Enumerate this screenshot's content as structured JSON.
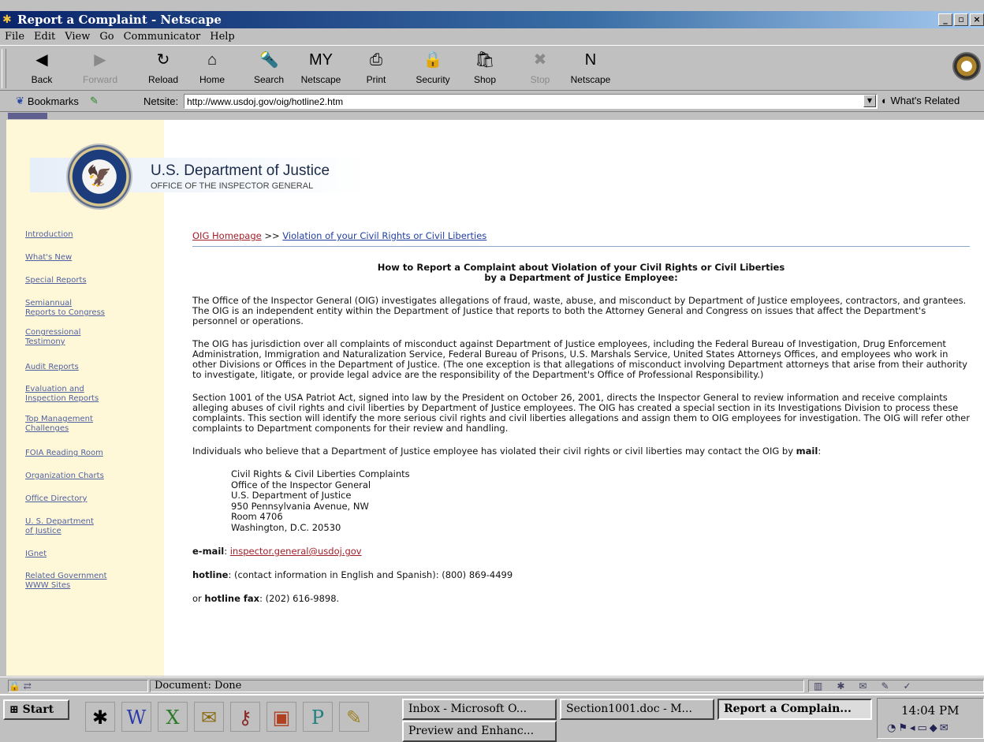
{
  "window": {
    "title": "Report a Complaint - Netscape"
  },
  "menu": [
    "File",
    "Edit",
    "View",
    "Go",
    "Communicator",
    "Help"
  ],
  "toolbar": [
    {
      "label": "Back",
      "icon": "◀",
      "disabled": false
    },
    {
      "label": "Forward",
      "icon": "▶",
      "disabled": true
    },
    {
      "label": "Reload",
      "icon": "↻",
      "disabled": false
    },
    {
      "label": "Home",
      "icon": "⌂",
      "disabled": false
    },
    {
      "label": "Search",
      "icon": "🔦",
      "disabled": false
    },
    {
      "label": "Netscape",
      "icon": "MY",
      "disabled": false
    },
    {
      "label": "Print",
      "icon": "⎙",
      "disabled": false
    },
    {
      "label": "Security",
      "icon": "🔒",
      "disabled": false
    },
    {
      "label": "Shop",
      "icon": "🛍",
      "disabled": false
    },
    {
      "label": "Stop",
      "icon": "✖",
      "disabled": true
    },
    {
      "label": "Netscape",
      "icon": "N",
      "disabled": false
    }
  ],
  "location": {
    "bookmarks_label": "Bookmarks",
    "netsite_label": "Netsite:",
    "url": "http://www.usdoj.gov/oig/hotline2.htm",
    "related_label": "What's Related"
  },
  "header": {
    "dept": "U.S. Department of Justice",
    "office": "OFFICE OF THE INSPECTOR GENERAL"
  },
  "nav": [
    [
      "Introduction"
    ],
    [
      "What's New"
    ],
    [
      "Special Reports"
    ],
    [
      "Semiannual",
      "Reports to Congress"
    ],
    [
      "Congressional",
      "Testimony"
    ],
    [
      "Audit Reports"
    ],
    [
      "Evaluation and",
      "Inspection Reports"
    ],
    [
      "Top Management",
      "Challenges"
    ],
    [
      "FOIA Reading Room"
    ],
    [
      "Organization Charts"
    ],
    [
      "Office Directory"
    ],
    [
      "U. S. Department",
      "of Justice"
    ],
    [
      "IGnet"
    ],
    [
      "Related Government",
      "WWW Sites"
    ]
  ],
  "breadcrumb": {
    "home": "OIG Homepage",
    "sep": ">>",
    "current": "Violation of your Civil Rights or Civil Liberties"
  },
  "heading": {
    "line1": "How to Report a Complaint about Violation of your Civil Rights or Civil Liberties",
    "line2": "by a Department of Justice Employee:"
  },
  "paragraphs": [
    "The Office of the Inspector General (OIG) investigates allegations of fraud, waste, abuse, and misconduct by Department of Justice employees, contractors, and grantees. The OIG is an independent entity within the Department of Justice that reports to both the Attorney General and Congress on issues that affect the Department's personnel or operations.",
    "The OIG has jurisdiction over all complaints of misconduct against Department of Justice employees, including the Federal Bureau of Investigation, Drug Enforcement Administration, Immigration and Naturalization Service, Federal Bureau of Prisons, U.S. Marshals Service, United States Attorneys Offices, and employees who work in other Divisions or Offices in the Department of Justice. (The one exception is that allegations of misconduct involving Department attorneys that arise from their authority to investigate, litigate, or provide legal advice are the responsibility of the Department's Office of Professional Responsibility.)",
    "Section 1001 of the USA Patriot Act, signed into law by the President on October 26, 2001, directs the Inspector General to review information and receive complaints alleging abuses of civil rights and civil liberties by Department of Justice employees. The OIG has created a special section in its Investigations Division to process these complaints. This section will identify the more serious civil rights and civil liberties allegations and assign them to OIG employees for investigation. The OIG will refer other complaints to Department components for their review and handling."
  ],
  "mail_intro": "Individuals who believe that a Department of Justice employee has violated their civil rights or civil liberties may contact the OIG by ",
  "mail_word": "mail",
  "mail_colon": ":",
  "address": [
    "Civil Rights & Civil Liberties Complaints",
    "Office of the Inspector General",
    "U.S. Department of Justice",
    "950 Pennsylvania Avenue, NW",
    "Room 4706",
    "Washington, D.C. 20530"
  ],
  "email": {
    "label": "e-mail",
    "colon": ":",
    "value": "inspector.general@usdoj.gov"
  },
  "hotline": {
    "label": "hotline",
    "text": ": (contact information in English and Spanish): (800) 869-4499"
  },
  "fax": {
    "prefix": "or ",
    "label": "hotline fax",
    "text": ": (202) 616-9898."
  },
  "status": {
    "text": "Document: Done"
  },
  "taskbar": {
    "start": "Start",
    "tasks": [
      "Inbox - Microsoft O...",
      "Section1001.doc - M...",
      "Report a Complain...",
      "Preview and Enhanc..."
    ],
    "clock": "14:04 PM"
  }
}
